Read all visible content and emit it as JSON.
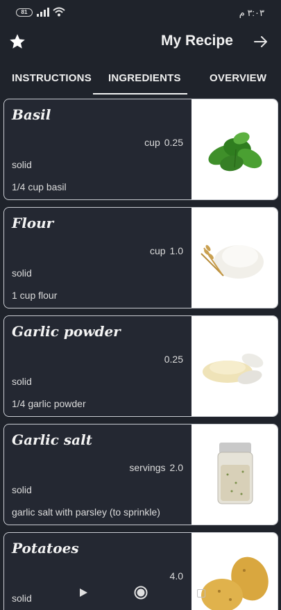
{
  "status": {
    "battery": "81",
    "time": "۳:۰۳ م"
  },
  "header": {
    "title": "My Recipe",
    "star_icon": "star-icon",
    "forward_icon": "arrow-right-icon"
  },
  "tabs": [
    {
      "label": "INSTRUCTIONS"
    },
    {
      "label": "INGREDIENTS"
    },
    {
      "label": "OVERVIEW"
    }
  ],
  "ingredients": [
    {
      "name": "Basil",
      "unit": "cup",
      "amount": "0.25",
      "state": "solid",
      "description": "1/4 cup basil",
      "image": "basil"
    },
    {
      "name": "Flour",
      "unit": "cup",
      "amount": "1.0",
      "state": "solid",
      "description": "1 cup flour",
      "image": "flour"
    },
    {
      "name": "Garlic powder",
      "unit": "",
      "amount": "0.25",
      "state": "solid",
      "description": "1/4 garlic powder",
      "image": "garlic-powder"
    },
    {
      "name": "Garlic salt",
      "unit": "servings",
      "amount": "2.0",
      "state": "solid",
      "description": "garlic salt with parsley (to sprinkle)",
      "image": "garlic-salt"
    },
    {
      "name": "Potatoes",
      "unit": "",
      "amount": "4.0",
      "state": "solid",
      "description": "",
      "image": "potatoes"
    }
  ],
  "colors": {
    "background": "#1f232b",
    "card": "#242832",
    "text": "#f2f2f2"
  }
}
